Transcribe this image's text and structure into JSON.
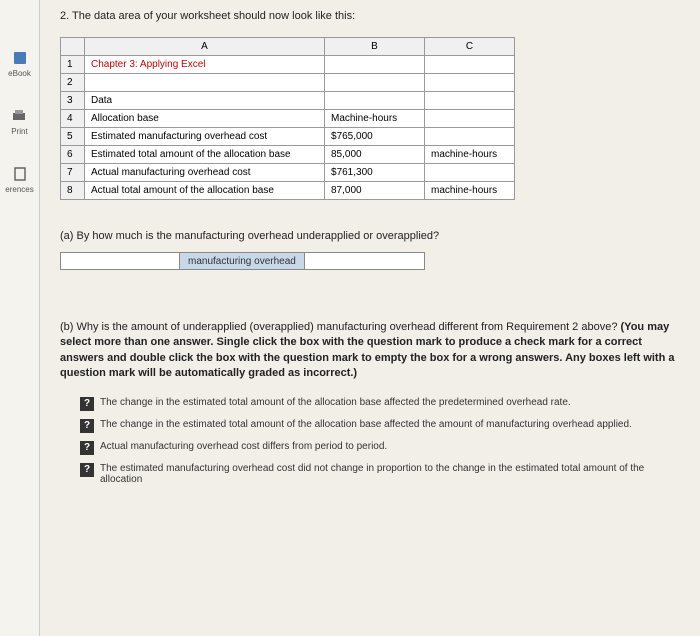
{
  "sidebar": {
    "items": [
      {
        "label": "eBook",
        "icon": "book"
      },
      {
        "label": "Print",
        "icon": "print"
      },
      {
        "label": "erences",
        "icon": "ref"
      }
    ]
  },
  "instruction": "2. The data area of your worksheet should now look like this:",
  "table": {
    "headers": {
      "rownum": "",
      "A": "A",
      "B": "B",
      "C": "C"
    },
    "rows": [
      {
        "n": "1",
        "A": "Chapter 3: Applying Excel",
        "B": "",
        "C": ""
      },
      {
        "n": "2",
        "A": "",
        "B": "",
        "C": ""
      },
      {
        "n": "3",
        "A": "Data",
        "B": "",
        "C": ""
      },
      {
        "n": "4",
        "A": "Allocation base",
        "B": "Machine-hours",
        "C": ""
      },
      {
        "n": "5",
        "A": "Estimated manufacturing overhead cost",
        "B_prefix": "$",
        "B": "765,000",
        "C": ""
      },
      {
        "n": "6",
        "A": "Estimated total amount of the allocation base",
        "B": "85,000",
        "C": "machine-hours"
      },
      {
        "n": "7",
        "A": "Actual manufacturing overhead cost",
        "B_prefix": "$",
        "B": "761,300",
        "C": ""
      },
      {
        "n": "8",
        "A": "Actual total amount of the allocation base",
        "B": "87,000",
        "C": "machine-hours"
      }
    ]
  },
  "part_a": {
    "question": "(a) By how much is the manufacturing overhead underapplied or overapplied?",
    "label": "manufacturing overhead"
  },
  "part_b": {
    "intro": "(b) Why is the amount of underapplied (overapplied) manufacturing overhead different from Requirement 2 above? ",
    "bold": "(You may select more than one answer. Single click the box with the question mark to produce a check mark for a correct answers and double click the box with the question mark to empty the box for a wrong answers. Any boxes left with a question mark will be automatically graded as incorrect.)",
    "options": [
      "The change in the estimated total amount of the allocation base affected the predetermined overhead rate.",
      "The change in the estimated total amount of the allocation base affected the amount of manufacturing overhead applied.",
      "Actual manufacturing overhead cost differs from period to period.",
      "The estimated manufacturing overhead cost did not change in proportion to the change in the estimated total amount of the allocation"
    ],
    "qmark": "?"
  }
}
